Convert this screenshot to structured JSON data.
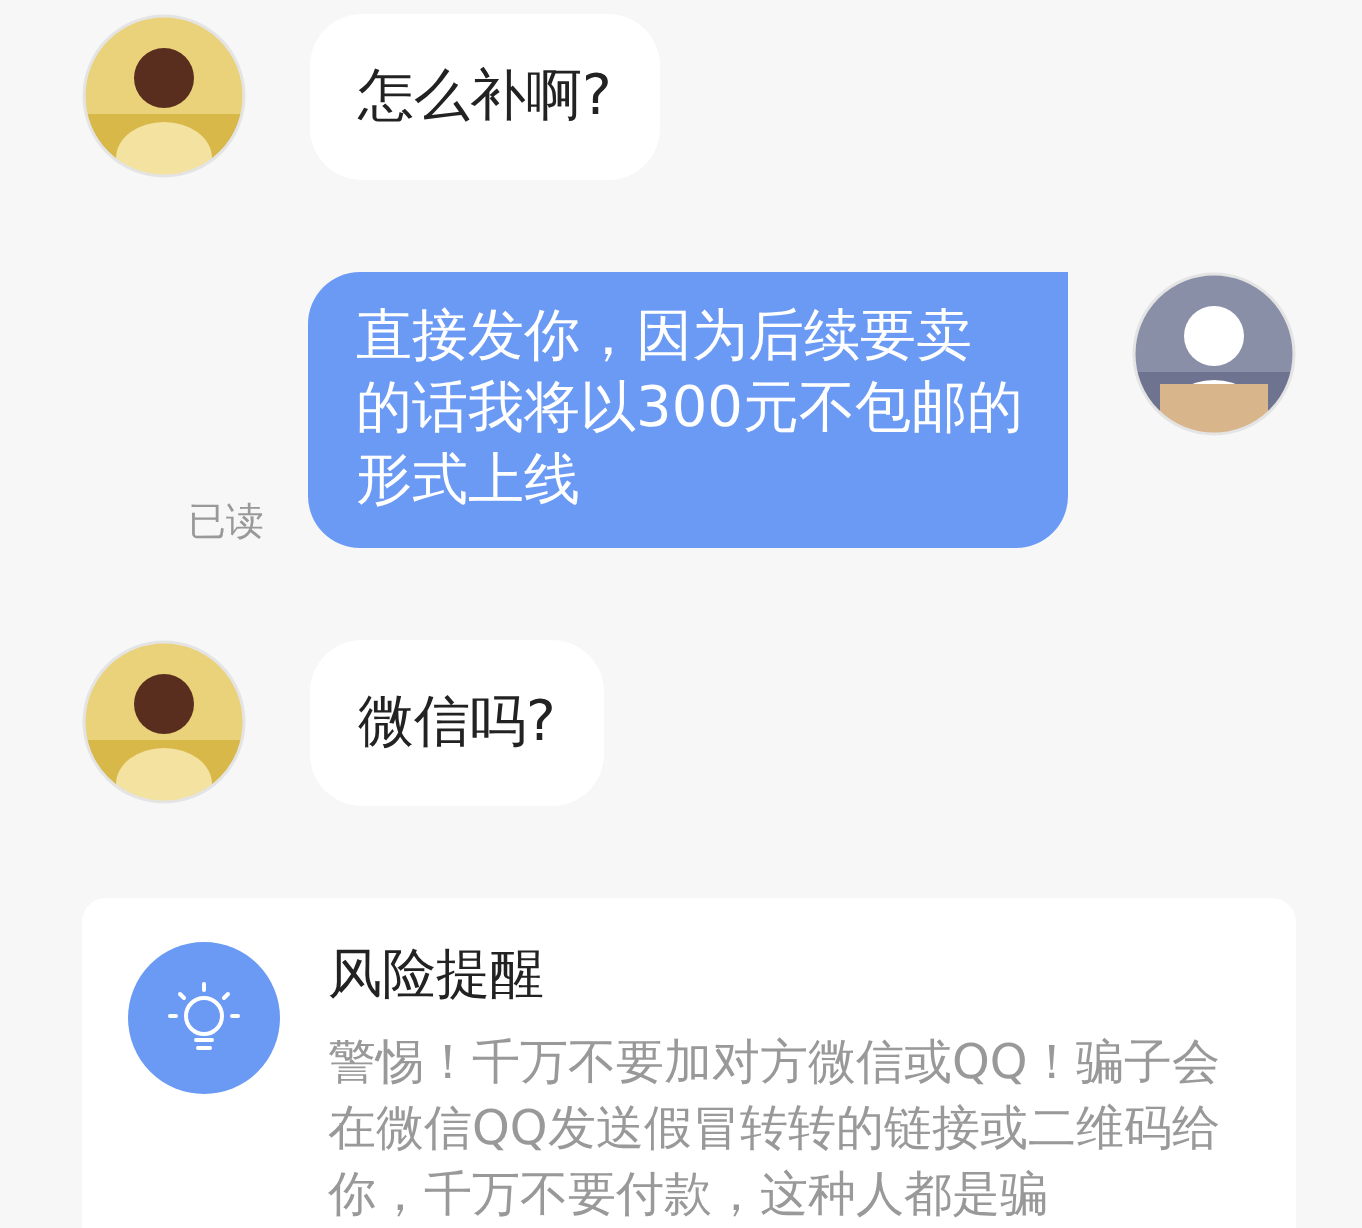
{
  "messages": [
    {
      "kind": "incoming",
      "text": "怎么补啊?"
    },
    {
      "kind": "outgoing",
      "text": "直接发你，因为后续要卖的话我将以300元不包邮的形式上线",
      "receipt": "已读"
    },
    {
      "kind": "incoming",
      "text": "微信吗?"
    }
  ],
  "risk_alert": {
    "title": "风险提醒",
    "body": "警惕！千万不要加对方微信或QQ！骗子会在微信QQ发送假冒转转的链接或二维码给你，千万不要付款，这种人都是骗"
  }
}
